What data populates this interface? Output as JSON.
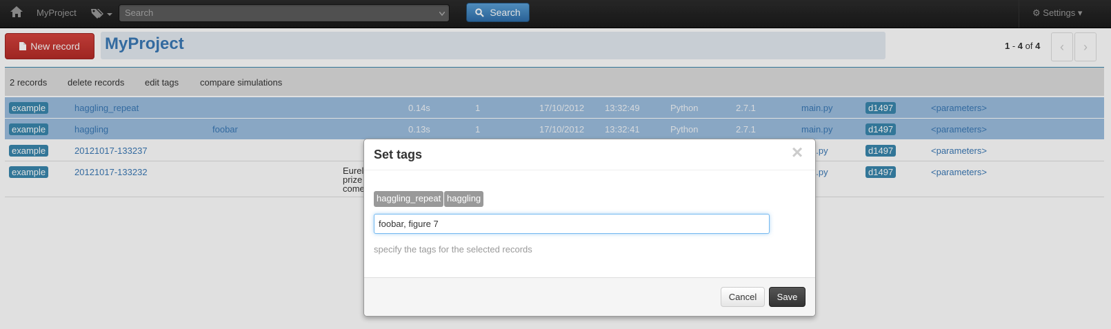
{
  "navbar": {
    "brand": "MyProject",
    "search_placeholder": "Search",
    "search_button": "Search",
    "settings_label": "Settings"
  },
  "header": {
    "new_record_label": "New record",
    "project_title": "MyProject",
    "paging": {
      "start": "1",
      "sep": " - ",
      "end": "4",
      "of": " of ",
      "total": "4"
    }
  },
  "toolbar": {
    "selected_count": "2 records",
    "delete": "delete records",
    "edit_tags": "edit tags",
    "compare": "compare simulations"
  },
  "records": [
    {
      "label": "example",
      "name": "haggling_repeat",
      "tags": "",
      "duration": "0.14s",
      "processes": "1",
      "date": "17/10/2012",
      "time": "13:32:49",
      "executable": "Python",
      "version": "2.7.1",
      "script": "main.py",
      "hash": "d1497",
      "params": "<parameters>",
      "selected": true
    },
    {
      "label": "example",
      "name": "haggling",
      "tags": "foobar",
      "duration": "0.13s",
      "processes": "1",
      "date": "17/10/2012",
      "time": "13:32:41",
      "executable": "Python",
      "version": "2.7.1",
      "script": "main.py",
      "hash": "d1497",
      "params": "<parameters>",
      "selected": true
    },
    {
      "label": "example",
      "name": "20121017-133237",
      "script": "n.py",
      "hash": "d1497",
      "params": "<parameters>",
      "selected": false
    },
    {
      "label": "example",
      "name": "20121017-133232",
      "reason_lines": [
        "Eurel",
        "prize",
        "come"
      ],
      "script": "n.py",
      "hash": "d1497",
      "params": "<parameters>",
      "selected": false
    }
  ],
  "modal": {
    "title": "Set tags",
    "close_glyph": "×",
    "existing_tags": [
      "haggling_repeat",
      "haggling"
    ],
    "input_value": "foobar, figure 7",
    "help": "specify the tags for the selected records",
    "cancel": "Cancel",
    "save": "Save"
  },
  "colors": {
    "accent": "#3a87ad",
    "danger": "#c9302c",
    "selected_row": "#9cbfe0"
  }
}
